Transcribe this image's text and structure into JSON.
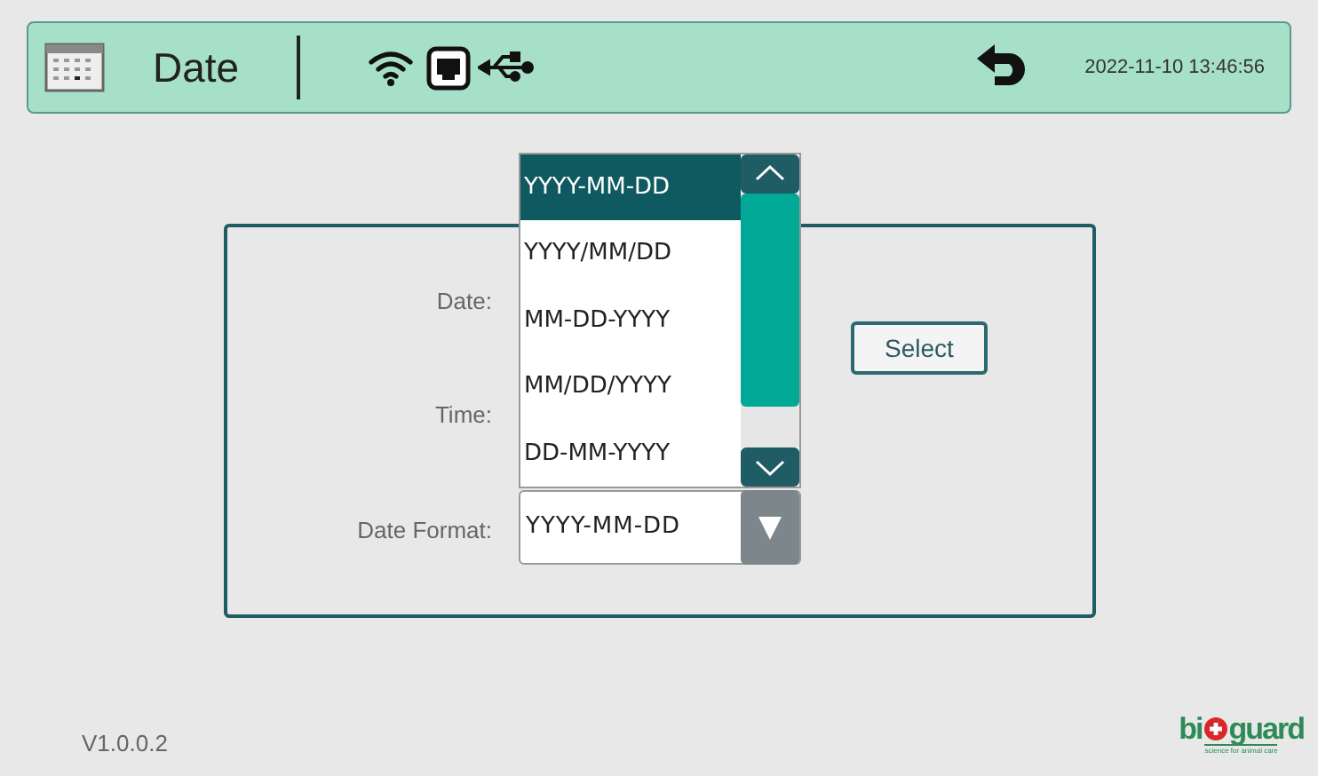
{
  "header": {
    "title": "Date",
    "datetime": "2022-11-10 13:46:56"
  },
  "form": {
    "labels": [
      {
        "text": "Date:"
      },
      {
        "text": "Time:"
      },
      {
        "text": "Date Format:"
      }
    ],
    "select_button": "Select",
    "date_format": {
      "value": "YYYY-MM-DD",
      "expanded": true,
      "options": [
        {
          "label": "YYYY-MM-DD",
          "selected": true
        },
        {
          "label": "YYYY/MM/DD",
          "selected": false
        },
        {
          "label": "MM-DD-YYYY",
          "selected": false
        },
        {
          "label": "MM/DD/YYYY",
          "selected": false
        },
        {
          "label": "DD-MM-YYYY",
          "selected": false
        }
      ]
    }
  },
  "footer": {
    "version": "V1.0.0.2",
    "logo_start": "bi",
    "logo_end": "guard",
    "tagline": "science for animal care"
  }
}
